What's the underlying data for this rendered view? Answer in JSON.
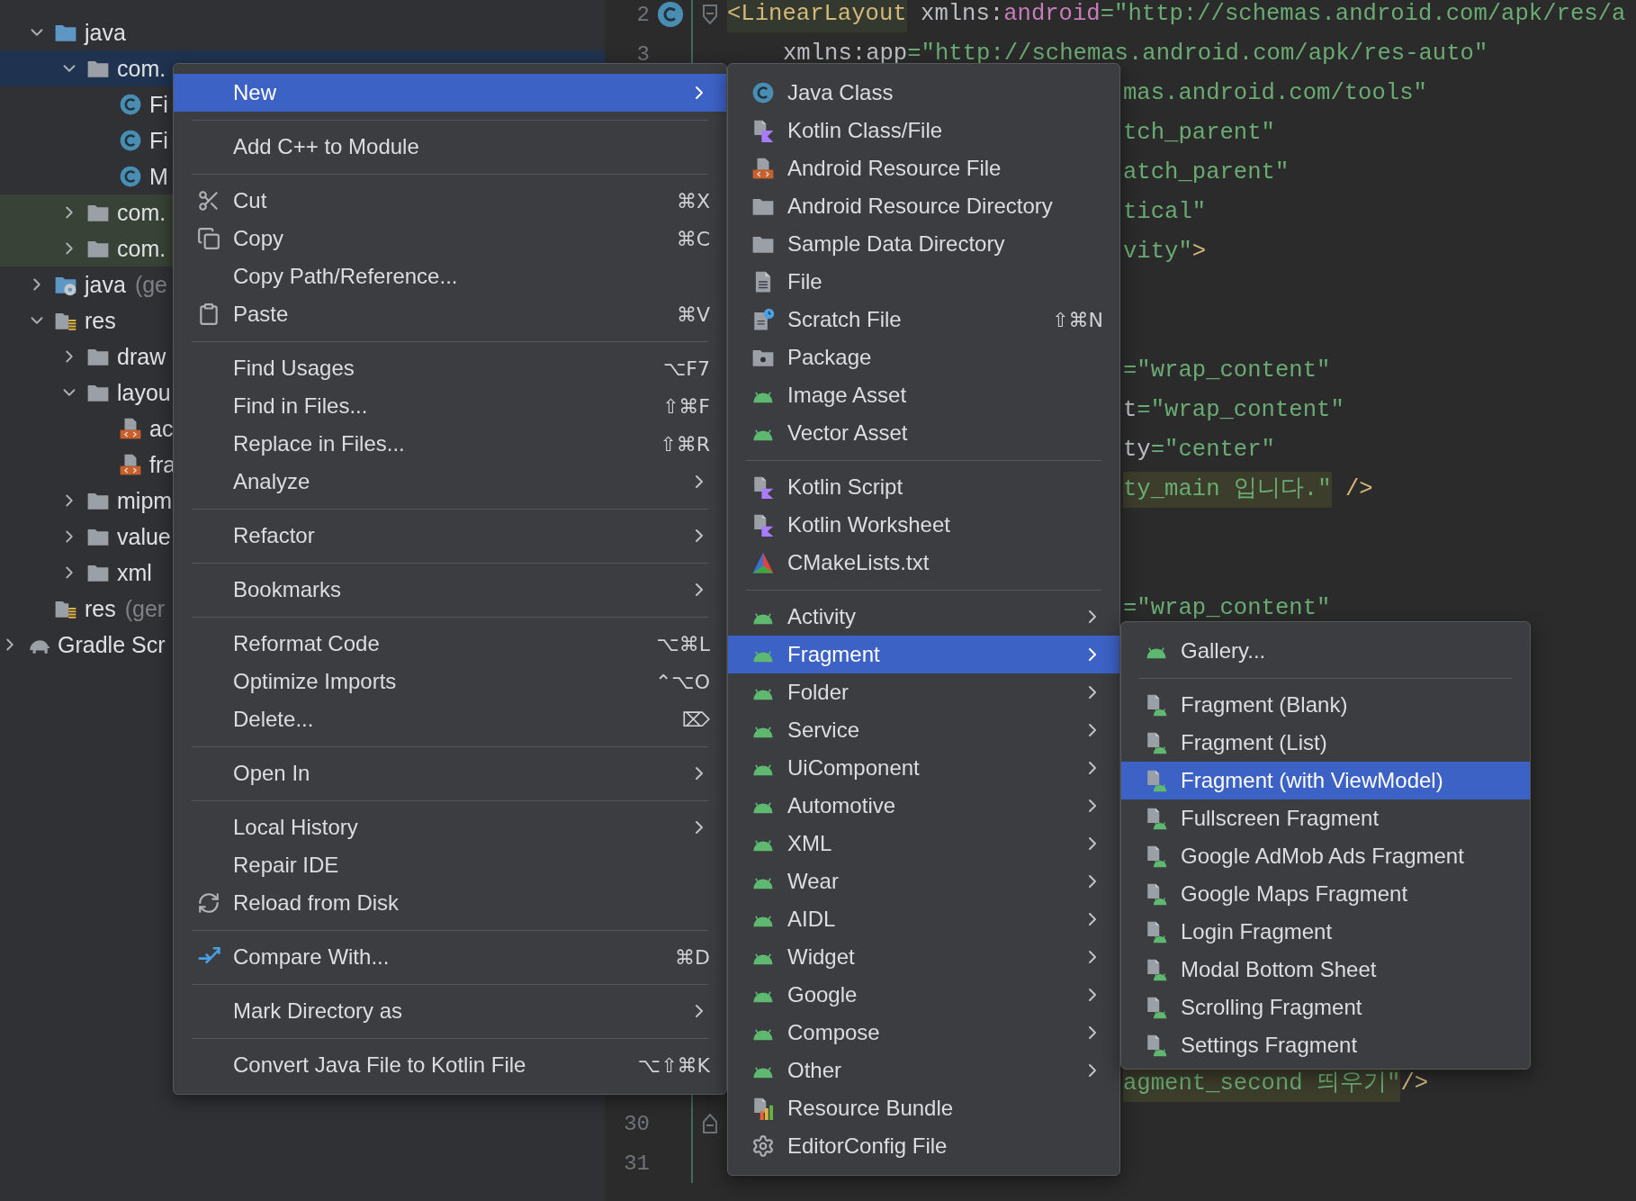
{
  "tree": {
    "items": [
      {
        "label": "java",
        "kind": "source-folder",
        "expanded": true,
        "selected": false,
        "scope_highlight": false,
        "children": [
          {
            "label": "com.",
            "kind": "folder",
            "expanded": true,
            "selected": true,
            "scope_highlight": false,
            "children": [
              {
                "label": "Fi",
                "kind": "class",
                "selected": false,
                "scope_highlight": false
              },
              {
                "label": "Fi",
                "kind": "class",
                "selected": false,
                "scope_highlight": false
              },
              {
                "label": "M",
                "kind": "class",
                "selected": false,
                "scope_highlight": false
              }
            ]
          },
          {
            "label": "com.",
            "kind": "folder",
            "expanded": false,
            "selected": false,
            "scope_highlight": true
          },
          {
            "label": "com.",
            "kind": "folder",
            "expanded": false,
            "selected": false,
            "scope_highlight": true
          }
        ]
      },
      {
        "label": "java",
        "hint": "(ge",
        "kind": "generated-folder",
        "expanded": false,
        "selected": false,
        "scope_highlight": false
      },
      {
        "label": "res",
        "kind": "resource-folder",
        "expanded": true,
        "selected": false,
        "scope_highlight": false,
        "children": [
          {
            "label": "draw",
            "kind": "folder",
            "expanded": false,
            "selected": false,
            "scope_highlight": false
          },
          {
            "label": "layou",
            "kind": "folder",
            "expanded": true,
            "selected": false,
            "scope_highlight": false,
            "children": [
              {
                "label": "ac",
                "kind": "layout-file",
                "selected": false,
                "scope_highlight": false
              },
              {
                "label": "fra",
                "kind": "layout-file",
                "selected": false,
                "scope_highlight": false
              }
            ]
          },
          {
            "label": "mipm",
            "kind": "folder",
            "expanded": false,
            "selected": false,
            "scope_highlight": false
          },
          {
            "label": "value",
            "kind": "folder",
            "expanded": false,
            "selected": false,
            "scope_highlight": false
          },
          {
            "label": "xml",
            "kind": "folder",
            "expanded": false,
            "selected": false,
            "scope_highlight": false
          }
        ]
      },
      {
        "label": "res",
        "hint": "(ger",
        "kind": "resource-folder",
        "selected": false,
        "scope_highlight": false
      }
    ],
    "root_rows": [
      {
        "label": "Gradle Scr",
        "kind": "gradle",
        "expanded": false,
        "selected": false,
        "scope_highlight": false
      }
    ]
  },
  "editor": {
    "lines": [
      {
        "number": "2",
        "kind": "full",
        "class_marker": true,
        "fold_start": true,
        "tokens": [
          {
            "kind": "tag-marked",
            "text": "<LinearLayout"
          },
          {
            "kind": "plain",
            "text": " xmlns:"
          },
          {
            "kind": "ns",
            "text": "android"
          },
          {
            "kind": "string",
            "text": "=\"http://schemas.android.com/apk/res/a"
          }
        ]
      },
      {
        "number": "3",
        "kind": "indented",
        "tokens": [
          {
            "kind": "plain",
            "text": "xmlns:app"
          },
          {
            "kind": "string",
            "text": "=\"http://schemas.android.com/apk/res-auto\""
          }
        ]
      },
      {
        "kind": "clipped",
        "tokens": [
          {
            "kind": "string",
            "text": "mas.android.com/tools\""
          }
        ]
      },
      {
        "kind": "clipped",
        "tokens": [
          {
            "kind": "string",
            "text": "tch_parent\""
          }
        ]
      },
      {
        "kind": "clipped",
        "tokens": [
          {
            "kind": "string",
            "text": "atch_parent\""
          }
        ]
      },
      {
        "kind": "clipped",
        "tokens": [
          {
            "kind": "string",
            "text": "tical\""
          }
        ]
      },
      {
        "kind": "clipped",
        "tokens": [
          {
            "kind": "string",
            "text": "vity\""
          },
          {
            "kind": "tag",
            "text": ">"
          }
        ]
      },
      {
        "kind": "blank"
      },
      {
        "kind": "blank"
      },
      {
        "kind": "clipped",
        "tokens": [
          {
            "kind": "string",
            "text": "=\"wrap_content\""
          }
        ]
      },
      {
        "kind": "clipped",
        "tokens": [
          {
            "kind": "plain",
            "text": "t"
          },
          {
            "kind": "string",
            "text": "=\"wrap_content\""
          }
        ]
      },
      {
        "kind": "clipped",
        "tokens": [
          {
            "kind": "plain",
            "text": "ty"
          },
          {
            "kind": "string",
            "text": "=\"center\""
          }
        ]
      },
      {
        "kind": "clipped",
        "tokens": [
          {
            "kind": "string-marked",
            "text": "ty_main 입니다.\""
          },
          {
            "kind": "tag",
            "text": " />"
          }
        ]
      },
      {
        "kind": "blank"
      },
      {
        "kind": "blank"
      },
      {
        "kind": "clipped",
        "tokens": [
          {
            "kind": "string",
            "text": "=\"wrap_content\""
          }
        ]
      },
      {
        "kind": "blank"
      },
      {
        "kind": "blank"
      },
      {
        "kind": "blank"
      },
      {
        "kind": "blank"
      },
      {
        "kind": "blank"
      },
      {
        "kind": "blank"
      },
      {
        "kind": "blank"
      },
      {
        "kind": "blank"
      },
      {
        "kind": "blank"
      },
      {
        "kind": "blank"
      },
      {
        "kind": "blank"
      },
      {
        "kind": "clipped",
        "tokens": [
          {
            "kind": "string-marked",
            "text": "agment_second 띄우기\""
          },
          {
            "kind": "tag",
            "text": "/>"
          }
        ]
      },
      {
        "number": "30",
        "kind": "blank",
        "fold_end": true
      },
      {
        "number": "31",
        "kind": "blank"
      }
    ]
  },
  "context_menu": {
    "items": [
      {
        "kind": "plain",
        "label": "New",
        "submenu": true,
        "selected": true
      },
      {
        "kind": "separator"
      },
      {
        "kind": "plain",
        "label": "Add C++ to Module",
        "submenu": false,
        "selected": false
      },
      {
        "kind": "separator"
      },
      {
        "kind": "cut",
        "label": "Cut",
        "shortcut": "⌘X",
        "submenu": false,
        "selected": false
      },
      {
        "kind": "copy",
        "label": "Copy",
        "shortcut": "⌘C",
        "submenu": false,
        "selected": false
      },
      {
        "kind": "plain",
        "label": "Copy Path/Reference...",
        "submenu": false,
        "selected": false
      },
      {
        "kind": "paste",
        "label": "Paste",
        "shortcut": "⌘V",
        "submenu": false,
        "selected": false
      },
      {
        "kind": "separator"
      },
      {
        "kind": "plain",
        "label": "Find Usages",
        "shortcut": "⌥F7",
        "submenu": false,
        "selected": false
      },
      {
        "kind": "plain",
        "label": "Find in Files...",
        "shortcut": "⇧⌘F",
        "submenu": false,
        "selected": false
      },
      {
        "kind": "plain",
        "label": "Replace in Files...",
        "shortcut": "⇧⌘R",
        "submenu": false,
        "selected": false
      },
      {
        "kind": "plain",
        "label": "Analyze",
        "submenu": true,
        "selected": false
      },
      {
        "kind": "separator"
      },
      {
        "kind": "plain",
        "label": "Refactor",
        "submenu": true,
        "selected": false
      },
      {
        "kind": "separator"
      },
      {
        "kind": "plain",
        "label": "Bookmarks",
        "submenu": true,
        "selected": false
      },
      {
        "kind": "separator"
      },
      {
        "kind": "plain",
        "label": "Reformat Code",
        "shortcut": "⌥⌘L",
        "submenu": false,
        "selected": false
      },
      {
        "kind": "plain",
        "label": "Optimize Imports",
        "shortcut": "⌃⌥O",
        "submenu": false,
        "selected": false
      },
      {
        "kind": "plain",
        "label": "Delete...",
        "shortcut": "⌦",
        "submenu": false,
        "selected": false
      },
      {
        "kind": "separator"
      },
      {
        "kind": "plain",
        "label": "Open In",
        "submenu": true,
        "selected": false
      },
      {
        "kind": "separator"
      },
      {
        "kind": "plain",
        "label": "Local History",
        "submenu": true,
        "selected": false
      },
      {
        "kind": "plain",
        "label": "Repair IDE",
        "submenu": false,
        "selected": false
      },
      {
        "kind": "reload",
        "label": "Reload from Disk",
        "submenu": false,
        "selected": false
      },
      {
        "kind": "separator"
      },
      {
        "kind": "compare",
        "label": "Compare With...",
        "shortcut": "⌘D",
        "submenu": false,
        "selected": false
      },
      {
        "kind": "separator"
      },
      {
        "kind": "plain",
        "label": "Mark Directory as",
        "submenu": true,
        "selected": false
      },
      {
        "kind": "separator"
      },
      {
        "kind": "plain",
        "label": "Convert Java File to Kotlin File",
        "shortcut": "⌥⇧⌘K",
        "submenu": false,
        "selected": false
      }
    ]
  },
  "new_submenu": {
    "items": [
      {
        "kind": "class",
        "label": "Java Class",
        "submenu": false,
        "selected": false
      },
      {
        "kind": "kotlin-file",
        "label": "Kotlin Class/File",
        "submenu": false,
        "selected": false
      },
      {
        "kind": "resource-file",
        "label": "Android Resource File",
        "submenu": false,
        "selected": false
      },
      {
        "kind": "folder",
        "label": "Android Resource Directory",
        "submenu": false,
        "selected": false
      },
      {
        "kind": "folder",
        "label": "Sample Data Directory",
        "submenu": false,
        "selected": false
      },
      {
        "kind": "file",
        "label": "File",
        "submenu": false,
        "selected": false
      },
      {
        "kind": "scratch",
        "label": "Scratch File",
        "shortcut": "⇧⌘N",
        "submenu": false,
        "selected": false
      },
      {
        "kind": "package",
        "label": "Package",
        "submenu": false,
        "selected": false
      },
      {
        "kind": "android",
        "label": "Image Asset",
        "submenu": false,
        "selected": false
      },
      {
        "kind": "android",
        "label": "Vector Asset",
        "submenu": false,
        "selected": false
      },
      {
        "kind": "separator"
      },
      {
        "kind": "kotlin-script",
        "label": "Kotlin Script",
        "submenu": false,
        "selected": false
      },
      {
        "kind": "kotlin-script",
        "label": "Kotlin Worksheet",
        "submenu": false,
        "selected": false
      },
      {
        "kind": "cmake",
        "label": "CMakeLists.txt",
        "submenu": false,
        "selected": false
      },
      {
        "kind": "separator"
      },
      {
        "kind": "android",
        "label": "Activity",
        "submenu": true,
        "selected": false
      },
      {
        "kind": "android",
        "label": "Fragment",
        "submenu": true,
        "selected": true
      },
      {
        "kind": "android",
        "label": "Folder",
        "submenu": true,
        "selected": false
      },
      {
        "kind": "android",
        "label": "Service",
        "submenu": true,
        "selected": false
      },
      {
        "kind": "android",
        "label": "UiComponent",
        "submenu": true,
        "selected": false
      },
      {
        "kind": "android",
        "label": "Automotive",
        "submenu": true,
        "selected": false
      },
      {
        "kind": "android",
        "label": "XML",
        "submenu": true,
        "selected": false
      },
      {
        "kind": "android",
        "label": "Wear",
        "submenu": true,
        "selected": false
      },
      {
        "kind": "android",
        "label": "AIDL",
        "submenu": true,
        "selected": false
      },
      {
        "kind": "android",
        "label": "Widget",
        "submenu": true,
        "selected": false
      },
      {
        "kind": "android",
        "label": "Google",
        "submenu": true,
        "selected": false
      },
      {
        "kind": "android",
        "label": "Compose",
        "submenu": true,
        "selected": false
      },
      {
        "kind": "android",
        "label": "Other",
        "submenu": true,
        "selected": false
      },
      {
        "kind": "bundle",
        "label": "Resource Bundle",
        "submenu": false,
        "selected": false
      },
      {
        "kind": "config",
        "label": "EditorConfig File",
        "submenu": false,
        "selected": false
      }
    ]
  },
  "fragment_submenu": {
    "items": [
      {
        "kind": "android",
        "label": "Gallery...",
        "submenu": false,
        "selected": false
      },
      {
        "kind": "separator"
      },
      {
        "kind": "fragment",
        "label": "Fragment (Blank)",
        "submenu": false,
        "selected": false
      },
      {
        "kind": "fragment",
        "label": "Fragment (List)",
        "submenu": false,
        "selected": false
      },
      {
        "kind": "fragment",
        "label": "Fragment (with ViewModel)",
        "submenu": false,
        "selected": true
      },
      {
        "kind": "fragment",
        "label": "Fullscreen Fragment",
        "submenu": false,
        "selected": false
      },
      {
        "kind": "fragment",
        "label": "Google AdMob Ads Fragment",
        "submenu": false,
        "selected": false
      },
      {
        "kind": "fragment",
        "label": "Google Maps Fragment",
        "submenu": false,
        "selected": false
      },
      {
        "kind": "fragment",
        "label": "Login Fragment",
        "submenu": false,
        "selected": false
      },
      {
        "kind": "fragment",
        "label": "Modal Bottom Sheet",
        "submenu": false,
        "selected": false
      },
      {
        "kind": "fragment",
        "label": "Scrolling Fragment",
        "submenu": false,
        "selected": false
      },
      {
        "kind": "fragment",
        "label": "Settings Fragment",
        "submenu": false,
        "selected": false
      }
    ]
  }
}
